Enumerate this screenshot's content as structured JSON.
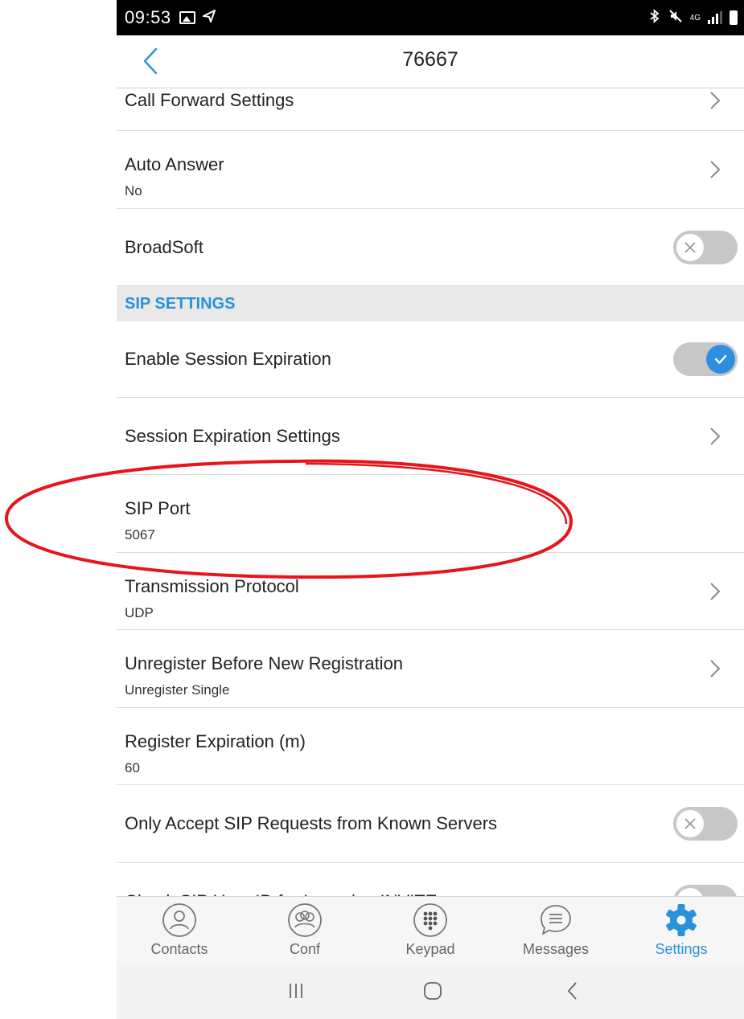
{
  "status_bar": {
    "time": "09:53",
    "network_type": "4G"
  },
  "header": {
    "title": "76667"
  },
  "settings_rows": [
    {
      "title": "Call Forward Settings",
      "control": "chevron"
    },
    {
      "title": "Auto Answer",
      "value": "No",
      "control": "chevron"
    },
    {
      "title": "BroadSoft",
      "control": "toggle",
      "checked": false
    },
    {
      "section": "SIP SETTINGS"
    },
    {
      "title": "Enable Session Expiration",
      "control": "toggle",
      "checked": true
    },
    {
      "title": "Session Expiration Settings",
      "control": "chevron"
    },
    {
      "title": "SIP Port",
      "value": "5067",
      "control": "none",
      "highlighted": true
    },
    {
      "title": "Transmission Protocol",
      "value": "UDP",
      "control": "chevron"
    },
    {
      "title": "Unregister Before New Registration",
      "value": "Unregister Single",
      "control": "chevron"
    },
    {
      "title": "Register Expiration (m)",
      "value": "60",
      "control": "none"
    },
    {
      "title": "Only Accept SIP Requests from Known Servers",
      "control": "toggle",
      "checked": false
    },
    {
      "title": "Check SIP User ID for Incoming INVITE",
      "control": "toggle",
      "checked": false
    }
  ],
  "tabbar": {
    "tabs": [
      {
        "label": "Contacts",
        "icon": "contacts-icon",
        "active": false
      },
      {
        "label": "Conf",
        "icon": "conference-icon",
        "active": false
      },
      {
        "label": "Keypad",
        "icon": "keypad-icon",
        "active": false
      },
      {
        "label": "Messages",
        "icon": "messages-icon",
        "active": false
      },
      {
        "label": "Settings",
        "icon": "settings-gear-icon",
        "active": true
      }
    ]
  },
  "colors": {
    "accent": "#2a92d8",
    "annotation": "#e8141b",
    "toggle_off": "#c7c7c7",
    "section_bg": "#e9e9e9"
  }
}
